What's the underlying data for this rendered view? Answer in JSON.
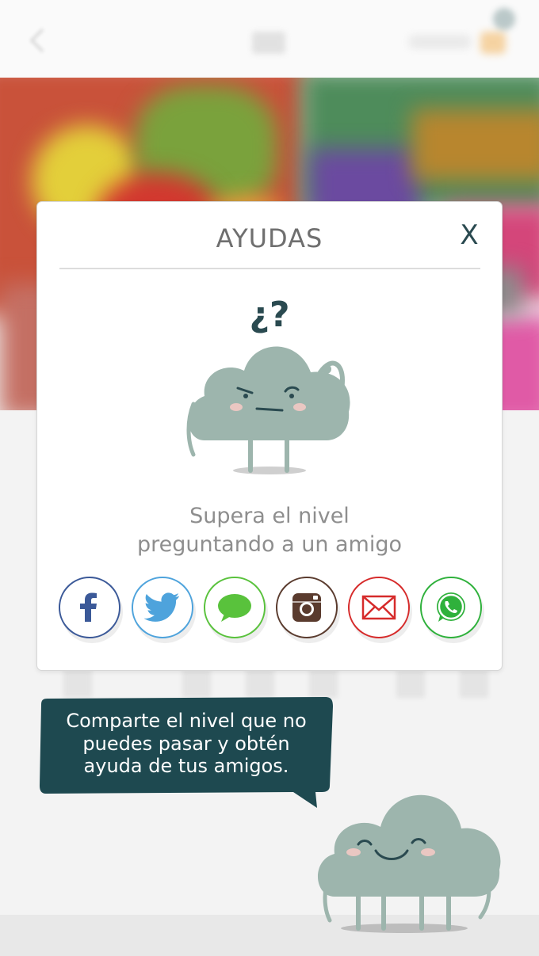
{
  "modal": {
    "title": "AYUDAS",
    "close_label": "X",
    "question_marks": "¿?",
    "message_line1": "Supera el nivel",
    "message_line2": "preguntando a un amigo"
  },
  "share_buttons": [
    {
      "name": "facebook",
      "icon": "facebook-icon",
      "color": "#3b5998"
    },
    {
      "name": "twitter",
      "icon": "twitter-icon",
      "color": "#4ea3dc"
    },
    {
      "name": "messages",
      "icon": "chat-bubble-icon",
      "color": "#59c23c"
    },
    {
      "name": "instagram",
      "icon": "instagram-icon",
      "color": "#5a3b2e"
    },
    {
      "name": "email",
      "icon": "envelope-icon",
      "color": "#d62b2b"
    },
    {
      "name": "whatsapp",
      "icon": "whatsapp-icon",
      "color": "#2fb13c"
    }
  ],
  "helper": {
    "line1": "Comparte el nivel que no",
    "line2": "puedes pasar y obtén",
    "line3": "ayuda de tus amigos."
  },
  "colors": {
    "cloud": "#9db5ad",
    "cloud_dark": "#2a4a50",
    "bubble": "#1e4950",
    "cheek": "#eac7c2"
  }
}
